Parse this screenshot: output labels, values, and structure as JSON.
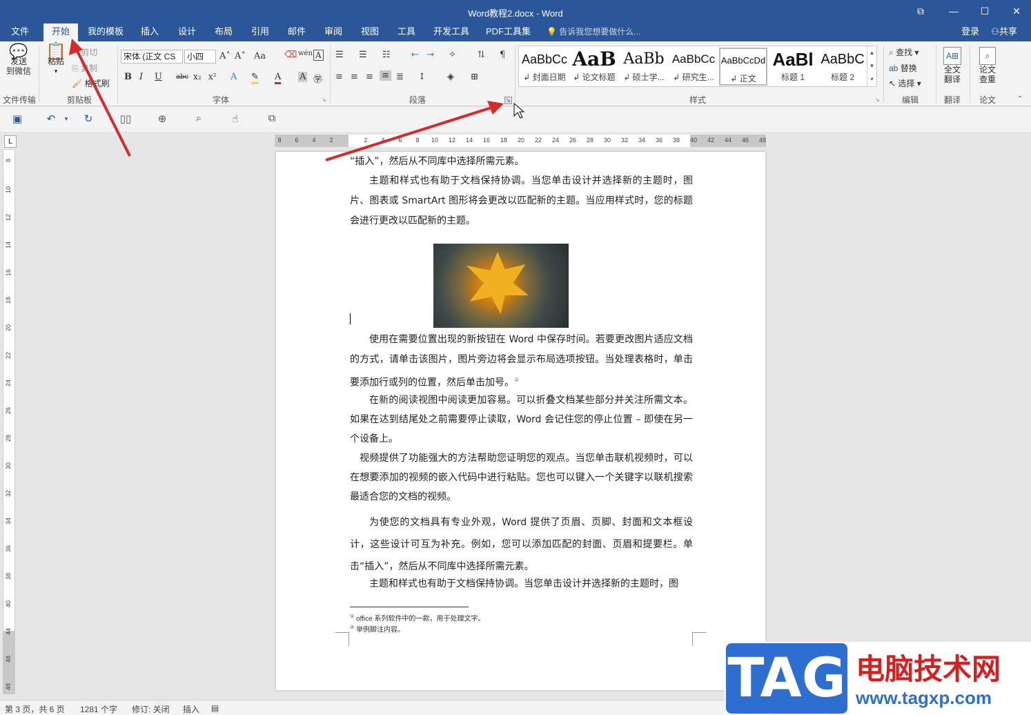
{
  "window": {
    "title": "Word教程2.docx - Word",
    "restore": "⧉",
    "minimize": "—",
    "maximize": "☐",
    "close": "✕"
  },
  "tabs": [
    "文件",
    "开始",
    "我的模板",
    "插入",
    "设计",
    "布局",
    "引用",
    "邮件",
    "审阅",
    "视图",
    "工具",
    "开发工具",
    "PDF工具集"
  ],
  "active_tab": "开始",
  "tell_me": "告诉我您想要做什么...",
  "account": {
    "login": "登录",
    "share": "共享"
  },
  "ribbon": {
    "send_wechat": "发送\n到微信",
    "groups": {
      "file_transfer": "文件传输",
      "clipboard": "剪贴板",
      "font": "字体",
      "paragraph": "段落",
      "styles": "样式",
      "editing": "编辑",
      "translate": "翻译",
      "paper": "论文"
    },
    "clipboard": {
      "paste": "粘贴",
      "cut": "剪切",
      "copy": "复制",
      "format_painter": "格式刷"
    },
    "font": {
      "name": "宋体 (正文 CS",
      "size": "小四",
      "bold": "B",
      "italic": "I",
      "underline": "U",
      "strike": "abc",
      "sub": "x₂",
      "sup": "x²",
      "grow": "A˄",
      "shrink": "A˅",
      "case": "Aa",
      "phonetic": "wén",
      "char_border": "A"
    },
    "styles": [
      {
        "preview": "AaBbCc",
        "label": "↲ 封面日期"
      },
      {
        "preview": "AaB",
        "label": "↲ 论文标题"
      },
      {
        "preview": "AaBb",
        "label": "↲ 硕士学..."
      },
      {
        "preview": "AaBbCc",
        "label": "↲ 研究生..."
      },
      {
        "preview": "AaBbCcDd",
        "label": "↲ 正文"
      },
      {
        "preview": "AaBl",
        "label": "标题 1"
      },
      {
        "preview": "AaBbC",
        "label": "标题 2"
      }
    ],
    "editing": {
      "find": "查找",
      "replace": "替换",
      "select": "选择"
    },
    "translate": "全文\n翻译",
    "paper": "论文\n查重"
  },
  "ruler_h": [
    "8",
    "6",
    "4",
    "2",
    "",
    "2",
    "4",
    "6",
    "8",
    "10",
    "12",
    "14",
    "16",
    "18",
    "20",
    "22",
    "24",
    "26",
    "28",
    "30",
    "32",
    "34",
    "36",
    "38",
    "40",
    "42",
    "44",
    "46",
    "48"
  ],
  "ruler_v": [
    "8",
    "10",
    "12",
    "14",
    "16",
    "18",
    "20",
    "22",
    "24",
    "26",
    "28",
    "30",
    "32",
    "34",
    "36",
    "38",
    "40",
    "44",
    "48",
    "48"
  ],
  "doc": {
    "p0": "“插入”，然后从不同库中选择所需元素。",
    "p1": "主题和样式也有助于文档保持协调。当您单击设计并选择新的主题时，图片、图表或 SmartArt 图形将会更改以匹配新的主题。当应用样式时，您的标题会进行更改以匹配新的主题。",
    "p2": "使用在需要位置出现的新按钮在 Word 中保存时间。若要更改图片适应文档的方式，请单击该图片，图片旁边将会显示布局选项按钮。当处理表格时，单击要添加行或列的位置，然后单击加号。",
    "p2_ref": "②",
    "p3": "在新的阅读视图中阅读更加容易。可以折叠文档某些部分并关注所需文本。如果在达到结尾处之前需要停止读取，Word 会记住您的停止位置 – 即使在另一个设备上。",
    "p4": "视频提供了功能强大的方法帮助您证明您的观点。当您单击联机视频时，可以在想要添加的视频的嵌入代码中进行粘贴。您也可以键入一个关键字以联机搜索最适合您的文档的视频。",
    "p5": "为使您的文档具有专业外观，Word 提供了页眉、页脚、封面和文本框设计，这些设计可互为补充。例如，您可以添加匹配的封面、页眉和提要栏。单击“插入”，然后从不同库中选择所需元素。",
    "p6": "主题和样式也有助于文档保持协调。当您单击设计并选择新的主题时，图",
    "fn1_mark": "①",
    "fn1": "office 系列软件中的一款，用于处理文字。",
    "fn2_mark": "②",
    "fn2": "举例脚注内容。"
  },
  "status": {
    "page": "第 3 页，共 6 页",
    "words": "1281 个字",
    "track": "修订: 关闭",
    "mode": "插入"
  },
  "watermark": {
    "tag": "TAG",
    "cn": "电脑技术网",
    "url": "www.tagxp.com"
  },
  "colors": {
    "accent": "#2b579a",
    "arrow": "#d42a2a"
  }
}
